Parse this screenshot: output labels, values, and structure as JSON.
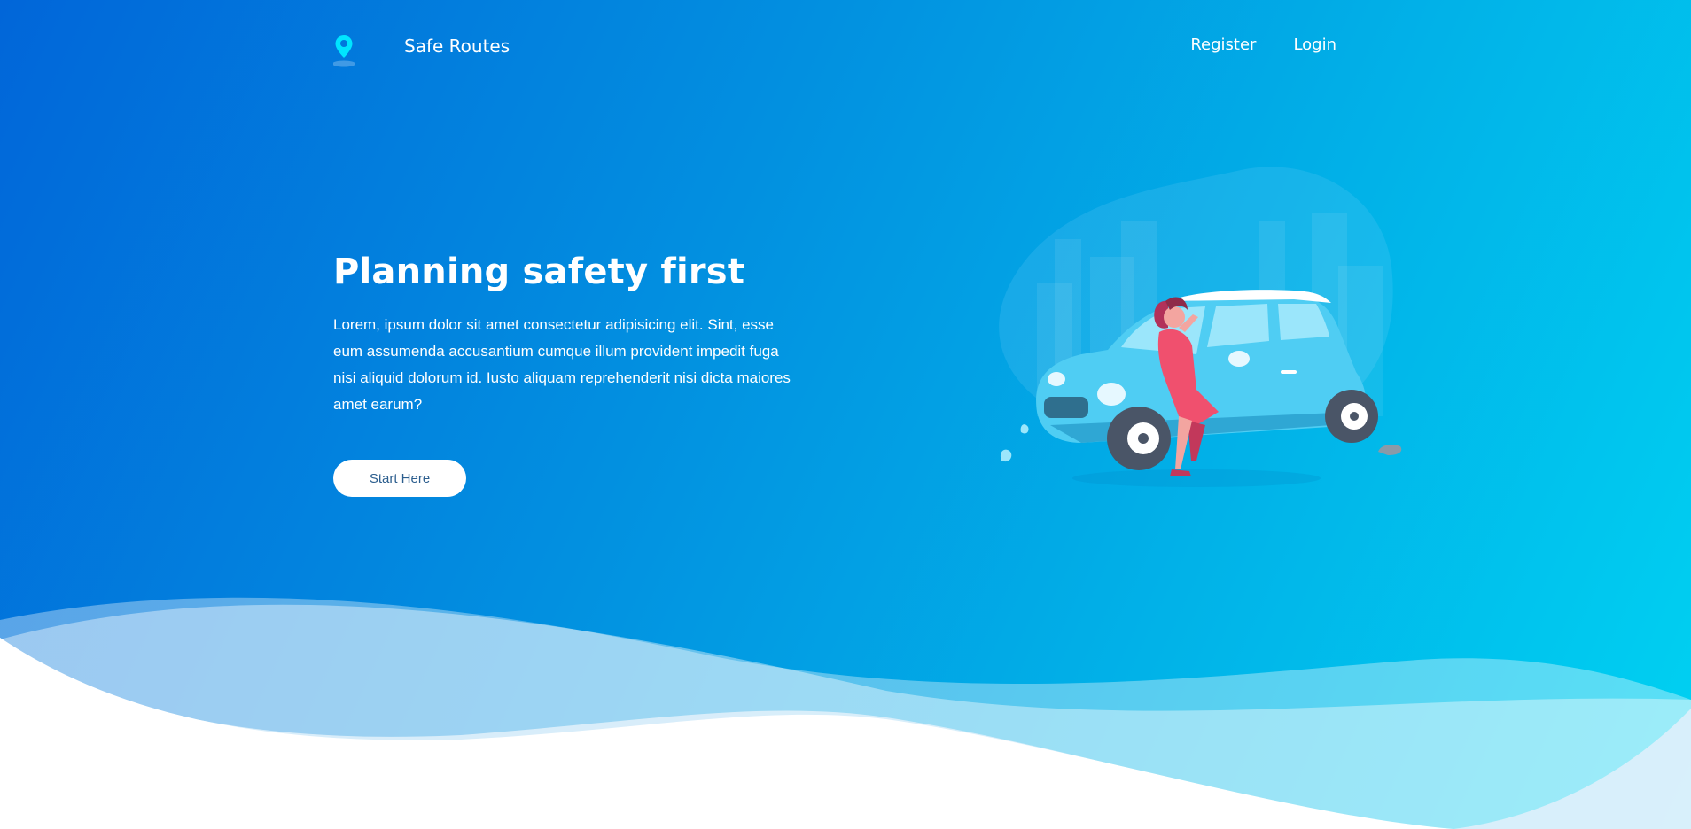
{
  "brand": {
    "name": "Safe Routes",
    "logo_icon": "map-pin-icon"
  },
  "nav": {
    "links": [
      {
        "label": "Register"
      },
      {
        "label": "Login"
      }
    ]
  },
  "hero": {
    "title": "Planning safety first",
    "text": "Lorem, ipsum dolor sit amet consectetur adipisicing elit. Sint, esse eum assumenda accusantium cumque illum provident impedit fuga nisi aliquid dolorum id. Iusto aliquam reprehenderit nisi dicta maiores amet earum?",
    "cta_label": "Start Here"
  },
  "colors": {
    "gradient_start": "#0166d9",
    "gradient_end": "#00d2f2",
    "accent_pin": "#00e5ff",
    "car": "#4fcdf3",
    "dress": "#f0506e"
  }
}
